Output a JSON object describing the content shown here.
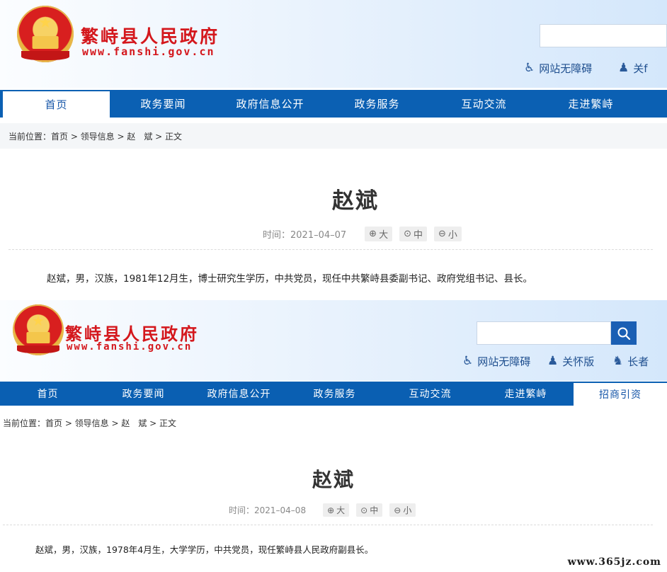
{
  "shots": [
    {
      "site_title": "繁峙县人民政府",
      "site_url": "www.fanshi.gov.cn",
      "tools": [
        "网站无障碍",
        "关f"
      ],
      "nav": [
        "首页",
        "政务要闻",
        "政府信息公开",
        "政务服务",
        "互动交流",
        "走进繁峙"
      ],
      "breadcrumb": "当前位置：首页 > 领导信息 > 赵　斌 > 正文",
      "title": "赵斌",
      "time": "时间：2021–04–07",
      "size_large": "大",
      "size_medium": "中",
      "size_small": "小",
      "body": "赵斌，男，汉族，1981年12月生，博士研究生学历，中共党员，现任中共繁峙县委副书记、政府党组书记、县长。"
    },
    {
      "site_title": "繁峙县人民政府",
      "site_url": "www.fanshi.gov.cn",
      "tools": [
        "网站无障碍",
        "关怀版",
        "长者"
      ],
      "nav": [
        "首页",
        "政务要闻",
        "政府信息公开",
        "政务服务",
        "互动交流",
        "走进繁峙",
        "招商引资"
      ],
      "breadcrumb": "当前位置：首页 > 领导信息 > 赵　斌 > 正文",
      "title": "赵斌",
      "time": "时间：2021–04–08",
      "size_large": "大",
      "size_medium": "中",
      "size_small": "小",
      "body": "赵斌，男，汉族，1978年4月生，大学学历，中共党员，现任繁峙县人民政府副县长。"
    }
  ],
  "watermark": "www.365jz.com",
  "icons": {
    "accessibility": "wheelchair-icon",
    "care": "care-person-icon",
    "elder": "elder-icon",
    "search": "search-icon",
    "zoom": "magnifier-icon"
  },
  "colors": {
    "brand_red": "#d4171c",
    "nav_blue": "#0b60b3",
    "link_blue": "#1f4f8f"
  }
}
